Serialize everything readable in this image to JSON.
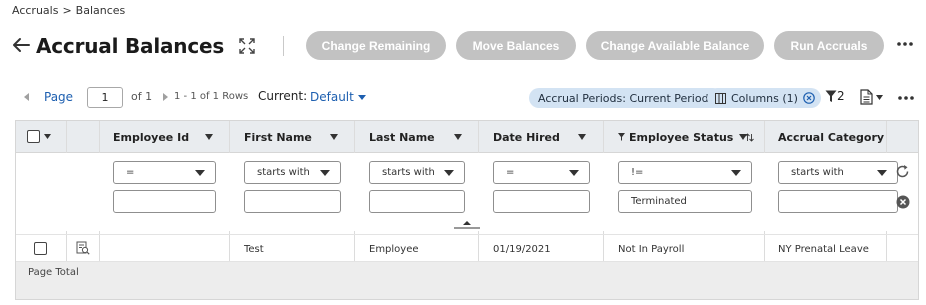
{
  "breadcrumb": {
    "root": "Accruals",
    "separator": ">",
    "current": "Balances"
  },
  "header": {
    "title": "Accrual Balances",
    "actions": [
      "Change Remaining",
      "Move Balances",
      "Change Available Balance",
      "Run Accruals"
    ]
  },
  "toolbar": {
    "page_label": "Page",
    "page_value": "1",
    "of_text": "of 1",
    "rows_text": "1 - 1 of 1 Rows",
    "current_label": "Current:",
    "current_value": "Default",
    "chips": [
      "Accrual Periods: Current Periods",
      "Columns (1)"
    ],
    "filter_count": "2"
  },
  "grid": {
    "columns": [
      "Employee Id",
      "First Name",
      "Last Name",
      "Date Hired",
      "Employee Status",
      "Accrual Category"
    ],
    "filters": [
      {
        "operator": "=",
        "value": ""
      },
      {
        "operator": "starts with",
        "value": ""
      },
      {
        "operator": "starts with",
        "value": ""
      },
      {
        "operator": "=",
        "value": ""
      },
      {
        "operator": "!=",
        "value": "Terminated"
      },
      {
        "operator": "starts with",
        "value": ""
      }
    ],
    "rows": [
      {
        "employee_id": "",
        "first_name": "Test",
        "last_name": "Employee",
        "date_hired": "01/19/2021",
        "employee_status": "Not In Payroll",
        "accrual_category": "NY Prenatal Leave"
      }
    ],
    "total_label": "Page Total"
  },
  "colors": {
    "link": "#1d5fb0",
    "disabled_button": "#c2c2c2",
    "chip": "#d3e3f3",
    "header_bg": "#e9ecef"
  }
}
